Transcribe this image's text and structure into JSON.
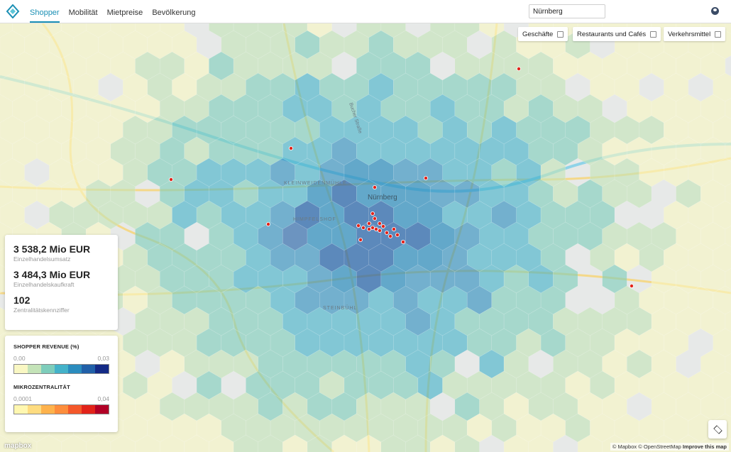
{
  "nav": {
    "items": [
      "Shopper",
      "Mobilität",
      "Mietpreise",
      "Bevölkerung"
    ],
    "active": 0
  },
  "search": {
    "value": "Nürnberg"
  },
  "poi_buttons": {
    "shops": "Geschäfte",
    "restaurants": "Restaurants und Cafés",
    "transit": "Verkehrsmittel"
  },
  "kpis": [
    {
      "value": "3 538,2 Mio EUR",
      "label": "Einzelhandelsumsatz"
    },
    {
      "value": "3 484,3 Mio EUR",
      "label": "Einzelhandelskaufkraft"
    },
    {
      "value": "102",
      "label": "Zentralitätskennziffer"
    }
  ],
  "legend": {
    "revenue": {
      "title": "SHOPPER REVENUE (%)",
      "min": "0,00",
      "max": "0,03",
      "colors": [
        "#f9f7c3",
        "#c4e3b8",
        "#7ecdbb",
        "#44b2c9",
        "#2b8cbe",
        "#2160a8",
        "#142a85"
      ]
    },
    "micro": {
      "title": "MIKROZENTRALITÄT",
      "min": "0,0001",
      "max": "0,04",
      "colors": [
        "#fff7b0",
        "#fedc80",
        "#feb24c",
        "#fd8d3c",
        "#f4582a",
        "#e2231a",
        "#b10026"
      ]
    }
  },
  "map_labels": {
    "city": "Nürnberg",
    "district1": "KLEINWEIDENMÜHLE",
    "district2": "HIMPFELSHOF",
    "district3": "STEINBÜHL",
    "street": "Bucher Straße"
  },
  "attribution": {
    "mapbox": "© Mapbox",
    "osm": "© OpenStreetMap",
    "improve": "Improve this map",
    "logo": "mapbox"
  },
  "icons": {
    "logo": "kepler-logo-icon",
    "user": "user-icon",
    "layers": "layers-icon"
  }
}
